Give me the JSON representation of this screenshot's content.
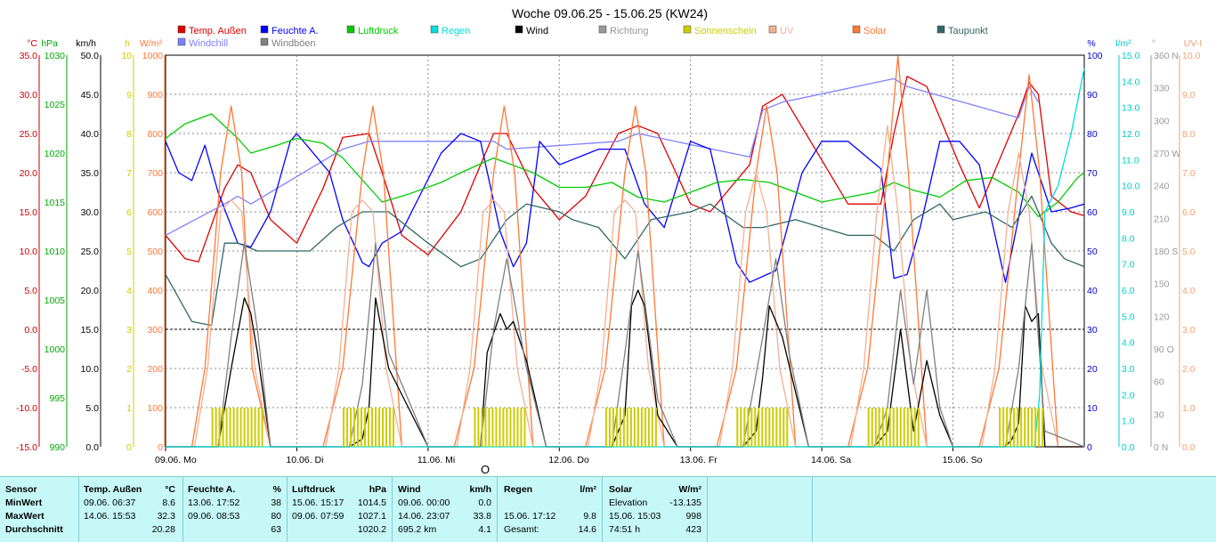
{
  "title": "Woche 09.06.25 - 15.06.25 (KW24)",
  "legend": [
    {
      "label": "Temp. Außen",
      "color": "#dd0000"
    },
    {
      "label": "Feuchte A.",
      "color": "#0000ff"
    },
    {
      "label": "Luftdruck",
      "color": "#00cc00"
    },
    {
      "label": "Regen",
      "color": "#00dddd"
    },
    {
      "label": "Wind",
      "color": "#000000"
    },
    {
      "label": "Richtung",
      "color": "#999999"
    },
    {
      "label": "Sonnenschein",
      "color": "#cccc00"
    },
    {
      "label": "UV",
      "color": "#f4b090"
    },
    {
      "label": "Solar",
      "color": "#ff7733"
    },
    {
      "label": "Taupunkt",
      "color": "#336666"
    },
    {
      "label": "Windchill",
      "color": "#8080ff"
    },
    {
      "label": "Windböen",
      "color": "#808080"
    }
  ],
  "chart_data": {
    "type": "line",
    "title": "Woche 09.06.25 - 15.06.25 (KW24)",
    "x_ticks": [
      "09.06. Mo",
      "10.06. Di",
      "11.06. Mi",
      "12.06. Do",
      "13.06. Fr",
      "14.06. Sa",
      "15.06. So"
    ],
    "axes_left": [
      {
        "unit": "°C",
        "color": "#cc0000",
        "ticks": [
          "35.0",
          "30.0",
          "25.0",
          "20.0",
          "15.0",
          "10.0",
          "5.0",
          "0.0",
          "-5.0",
          "-10.0",
          "-15.0"
        ]
      },
      {
        "unit": "hPa",
        "color": "#00aa00",
        "ticks": [
          "1030",
          "1025",
          "1020",
          "1015",
          "1010",
          "1005",
          "1000",
          "995",
          "990"
        ]
      },
      {
        "unit": "km/h",
        "color": "#000000",
        "ticks": [
          "50.0",
          "45.0",
          "40.0",
          "35.0",
          "30.0",
          "25.0",
          "20.0",
          "15.0",
          "10.0",
          "5.0",
          "0.0"
        ]
      },
      {
        "unit": "h",
        "color": "#cccc00",
        "ticks": [
          "10",
          "9",
          "8",
          "7",
          "6",
          "5",
          "4",
          "3",
          "2",
          "1",
          "0"
        ]
      },
      {
        "unit": "W/m²",
        "color": "#ff7733",
        "ticks": [
          "1000",
          "900",
          "800",
          "700",
          "600",
          "500",
          "400",
          "300",
          "200",
          "100",
          "0"
        ]
      }
    ],
    "axes_right": [
      {
        "unit": "%",
        "color": "#0000cc",
        "ticks": [
          "100",
          "90",
          "80",
          "70",
          "60",
          "50",
          "40",
          "30",
          "20",
          "10",
          "0"
        ]
      },
      {
        "unit": "l/m²",
        "color": "#00cccc",
        "ticks": [
          "15.0",
          "14.0",
          "13.0",
          "12.0",
          "11.0",
          "10.0",
          "9.0",
          "8.0",
          "7.0",
          "6.0",
          "5.0",
          "4.0",
          "3.0",
          "2.0",
          "1.0",
          "0.0"
        ]
      },
      {
        "unit": "°",
        "color": "#999999",
        "ticks": [
          "360 N",
          "330",
          "300",
          "270 W",
          "240",
          "210",
          "180 S",
          "150",
          "120",
          "90 O",
          "60",
          "30",
          "0 N"
        ]
      },
      {
        "unit": "UV-I",
        "color": "#f4a070",
        "ticks": [
          "10.0",
          "9.0",
          "8.0",
          "7.0",
          "6.0",
          "5.0",
          "4.0",
          "3.0",
          "2.0",
          "1.0",
          "0.0"
        ]
      }
    ],
    "series": [
      {
        "name": "Temp. Außen",
        "color": "#dd0000",
        "axis": "°C",
        "x": [
          0,
          0.15,
          0.25,
          0.45,
          0.55,
          0.65,
          0.8,
          1.0,
          1.2,
          1.35,
          1.55,
          1.65,
          1.8,
          2.0,
          2.25,
          2.5,
          2.6,
          2.8,
          3.0,
          3.2,
          3.45,
          3.6,
          3.75,
          4.0,
          4.15,
          4.45,
          4.55,
          4.7,
          4.95,
          5.2,
          5.45,
          5.55,
          5.65,
          5.8,
          5.9,
          6.05,
          6.2,
          6.5,
          6.58,
          6.65,
          6.75,
          6.9,
          7.0
        ],
        "y": [
          12,
          9,
          8.6,
          18,
          21,
          20,
          14,
          11,
          18,
          24.5,
          25,
          20,
          12,
          9.5,
          15,
          25,
          25,
          18,
          14,
          17,
          25,
          26,
          25,
          16,
          15,
          21,
          28.5,
          30,
          23,
          16,
          16,
          25,
          32.3,
          31,
          27,
          21,
          15.5,
          27.5,
          31.5,
          30,
          17,
          15,
          14.5
        ]
      },
      {
        "name": "Windchill",
        "color": "#8080ff",
        "axis": "°C",
        "x": [
          0,
          0.45,
          0.55,
          0.65,
          1.35,
          1.55,
          2.5,
          2.6,
          3.45,
          3.6,
          4.45,
          4.55,
          4.7,
          5.55,
          5.65,
          6.5,
          6.58,
          6.65
        ],
        "y": [
          12,
          16,
          17,
          16,
          23,
          24,
          24,
          23,
          24,
          25,
          22,
          28,
          29,
          32,
          31,
          27,
          31,
          29
        ]
      },
      {
        "name": "Feuchte A.",
        "color": "#0000ff",
        "axis": "%",
        "x": [
          0,
          0.1,
          0.2,
          0.3,
          0.4,
          0.55,
          0.65,
          0.8,
          0.95,
          1.0,
          1.1,
          1.25,
          1.35,
          1.5,
          1.55,
          1.65,
          1.8,
          2.1,
          2.25,
          2.4,
          2.55,
          2.65,
          2.75,
          2.85,
          3.0,
          3.3,
          3.5,
          3.65,
          3.8,
          4.0,
          4.15,
          4.35,
          4.45,
          4.65,
          4.85,
          5.0,
          5.2,
          5.45,
          5.55,
          5.65,
          5.75,
          5.9,
          6.05,
          6.2,
          6.4,
          6.6,
          6.75,
          6.9,
          7.0
        ],
        "y": [
          78,
          70,
          68,
          77,
          65,
          52,
          51,
          60,
          78,
          80,
          76,
          70,
          58,
          47,
          46,
          52,
          55,
          75,
          80,
          78,
          55,
          46,
          52,
          78,
          72,
          76,
          76,
          62,
          56,
          78,
          76,
          47,
          42,
          45,
          70,
          78,
          78,
          71,
          43,
          44,
          56,
          78,
          78,
          72,
          42,
          75,
          60,
          61,
          62
        ]
      },
      {
        "name": "Luftdruck",
        "color": "#00cc00",
        "axis": "hPa",
        "x": [
          0,
          0.15,
          0.35,
          0.55,
          0.65,
          0.85,
          1.0,
          1.2,
          1.35,
          1.55,
          1.65,
          1.85,
          2.1,
          2.25,
          2.5,
          2.6,
          2.8,
          3.0,
          3.2,
          3.4,
          3.6,
          3.8,
          4.0,
          4.2,
          4.4,
          4.6,
          4.8,
          5.0,
          5.2,
          5.4,
          5.55,
          5.7,
          5.9,
          6.1,
          6.3,
          6.5,
          6.65,
          6.8,
          6.95,
          7.0
        ],
        "y": [
          1021.5,
          1023,
          1024,
          1021.5,
          1020,
          1020.8,
          1021.5,
          1021,
          1019.5,
          1016.5,
          1015,
          1015.8,
          1017,
          1018,
          1019.5,
          1019,
          1018,
          1016.5,
          1016.5,
          1017,
          1015.5,
          1015,
          1016,
          1017,
          1017.3,
          1017,
          1016,
          1015,
          1015.5,
          1016,
          1017,
          1016.2,
          1015.5,
          1017.2,
          1017.5,
          1016,
          1013.5,
          1015,
          1017.5,
          1018
        ]
      },
      {
        "name": "Taupunkt",
        "color": "#336666",
        "axis": "°C",
        "x": [
          0,
          0.2,
          0.35,
          0.45,
          0.55,
          0.7,
          0.9,
          1.1,
          1.3,
          1.5,
          1.7,
          2.0,
          2.25,
          2.4,
          2.6,
          2.75,
          3.0,
          3.1,
          3.3,
          3.5,
          3.7,
          4.0,
          4.15,
          4.4,
          4.55,
          4.8,
          5.0,
          5.2,
          5.4,
          5.55,
          5.7,
          5.9,
          6.0,
          6.25,
          6.45,
          6.6,
          6.75,
          6.85,
          7.0
        ],
        "y": [
          7,
          1,
          0.5,
          11,
          11,
          10,
          10,
          10,
          13,
          15,
          15,
          11,
          8,
          9,
          14,
          16,
          15,
          14,
          13,
          9,
          14,
          15,
          16,
          13,
          13,
          14,
          13,
          12,
          12,
          10,
          14,
          16,
          14,
          15,
          13,
          17,
          11,
          9,
          8
        ]
      },
      {
        "name": "Solar",
        "color": "#ff7733",
        "axis": "W/m²",
        "x": [
          0,
          0.2,
          0.3,
          0.42,
          0.5,
          0.58,
          0.66,
          0.8,
          1.2,
          1.35,
          1.5,
          1.58,
          1.66,
          1.8,
          2.2,
          2.35,
          2.5,
          2.58,
          2.66,
          2.8,
          3.2,
          3.35,
          3.5,
          3.58,
          3.66,
          3.8,
          4.2,
          4.35,
          4.5,
          4.58,
          4.66,
          4.8,
          5.2,
          5.35,
          5.5,
          5.58,
          5.66,
          5.8,
          6.2,
          6.35,
          6.5,
          6.58,
          6.66,
          6.8,
          7.0
        ],
        "y": [
          0,
          0,
          200,
          700,
          870,
          700,
          200,
          0,
          0,
          200,
          700,
          870,
          700,
          0,
          0,
          200,
          700,
          870,
          700,
          0,
          0,
          200,
          700,
          870,
          700,
          0,
          0,
          200,
          700,
          870,
          700,
          0,
          0,
          200,
          700,
          998,
          700,
          0,
          0,
          200,
          700,
          950,
          700,
          0,
          0
        ]
      },
      {
        "name": "UV",
        "color": "#f4b090",
        "axis": "UV-I",
        "x": [
          0,
          0.22,
          0.32,
          0.42,
          0.5,
          0.58,
          0.68,
          0.8,
          1.22,
          1.32,
          1.42,
          1.5,
          1.58,
          1.68,
          1.8,
          2.22,
          2.32,
          2.42,
          2.5,
          2.58,
          2.68,
          2.8,
          3.22,
          3.32,
          3.42,
          3.5,
          3.58,
          3.68,
          3.8,
          4.22,
          4.32,
          4.42,
          4.5,
          4.58,
          4.68,
          4.8,
          5.22,
          5.32,
          5.42,
          5.5,
          5.58,
          5.68,
          5.8,
          6.22,
          6.32,
          6.42,
          6.5,
          6.58,
          6.68,
          6.8,
          7.0
        ],
        "y": [
          0,
          0,
          2,
          6,
          6.3,
          6,
          2,
          0,
          0,
          2,
          6,
          6.3,
          6,
          2,
          0,
          0,
          2,
          6,
          6.3,
          6,
          2,
          0,
          0,
          2,
          6,
          6.3,
          6,
          2,
          0,
          0,
          2,
          6,
          7,
          6,
          2,
          0,
          0,
          2,
          6,
          8.2,
          6,
          2,
          0,
          0,
          2,
          6,
          7.5,
          6,
          2,
          0,
          0
        ]
      },
      {
        "name": "Wind",
        "color": "#000000",
        "axis": "km/h",
        "x": [
          0,
          0.4,
          0.5,
          0.6,
          0.65,
          0.7,
          0.8,
          1.0,
          1.4,
          1.5,
          1.55,
          1.6,
          1.7,
          2.0,
          2.4,
          2.45,
          2.55,
          2.6,
          2.65,
          2.75,
          2.9,
          3.0,
          3.4,
          3.5,
          3.55,
          3.6,
          3.65,
          3.75,
          3.9,
          4.0,
          4.4,
          4.5,
          4.55,
          4.6,
          4.7,
          4.9,
          5.0,
          5.4,
          5.5,
          5.6,
          5.7,
          5.8,
          5.9,
          6.0,
          6.4,
          6.45,
          6.5,
          6.55,
          6.6,
          6.65,
          6.7,
          7.0
        ],
        "y": [
          0,
          0,
          10,
          19,
          17,
          12,
          0,
          0,
          0,
          1,
          5,
          19,
          10,
          0,
          0,
          12,
          17,
          15,
          16,
          11,
          0,
          0,
          0,
          4,
          18,
          20,
          18,
          4,
          0,
          0,
          0,
          2,
          9,
          18,
          14,
          0,
          0,
          0,
          2,
          15,
          2,
          11,
          4,
          0,
          0,
          1,
          3,
          18,
          16,
          17,
          0,
          0
        ]
      },
      {
        "name": "Windböen",
        "color": "#808080",
        "axis": "km/h",
        "x": [
          0,
          0.4,
          0.5,
          0.6,
          0.7,
          0.8,
          1.0,
          1.4,
          1.5,
          1.6,
          1.7,
          2.0,
          2.4,
          2.5,
          2.6,
          2.75,
          2.9,
          3.0,
          3.4,
          3.5,
          3.6,
          3.75,
          3.9,
          4.0,
          4.4,
          4.55,
          4.65,
          4.75,
          4.9,
          5.0,
          5.4,
          5.5,
          5.6,
          5.7,
          5.8,
          5.9,
          6.0,
          6.4,
          6.5,
          6.6,
          6.7,
          7.0
        ],
        "y": [
          0,
          0,
          14,
          26,
          15,
          0,
          0,
          0,
          8,
          26,
          12,
          0,
          0,
          15,
          24,
          10,
          0,
          0,
          0,
          12,
          25,
          6,
          0,
          0,
          0,
          14,
          24,
          12,
          0,
          0,
          0,
          5,
          20,
          8,
          20,
          5,
          0,
          0,
          10,
          26,
          2,
          0
        ]
      },
      {
        "name": "Regen",
        "color": "#00dddd",
        "axis": "l/m²",
        "x": [
          0,
          6.62,
          6.66,
          6.7,
          6.8,
          6.9,
          7.0
        ],
        "y": [
          0,
          0,
          2,
          9,
          10,
          12,
          14.5
        ]
      },
      {
        "name": "Sonnenschein",
        "color": "#cccc00",
        "axis": "h",
        "x": [
          0.35,
          0.75,
          1.35,
          1.75,
          2.35,
          2.75,
          3.35,
          3.75,
          4.35,
          4.75,
          5.35,
          5.75,
          6.35,
          6.7
        ],
        "y": [
          1,
          1,
          1,
          1,
          1,
          1,
          1,
          1,
          1,
          1,
          1,
          1,
          1,
          1
        ]
      }
    ]
  },
  "stats": {
    "sensor": {
      "title": "Sensor",
      "rows": [
        "MinWert",
        "MaxWert",
        "Durchschnitt"
      ]
    },
    "temp": {
      "title": "Temp. Außen",
      "unit": "°C",
      "min": {
        "time": "09.06.  06:37",
        "value": "8.6"
      },
      "max": {
        "time": "14.06.  15:53",
        "value": "32.3"
      },
      "avg": "20.28"
    },
    "feuchte": {
      "title": "Feuchte A.",
      "unit": "%",
      "min": {
        "time": "13.06.  17:52",
        "value": "38"
      },
      "max": {
        "time": "09.06.  08:53",
        "value": "80"
      },
      "avg": "63"
    },
    "luftdruck": {
      "title": "Luftdruck",
      "unit": "hPa",
      "min": {
        "time": "15.06.  15:17",
        "value": "1014.5"
      },
      "max": {
        "time": "09.06.  07:59",
        "value": "1027.1"
      },
      "avg": "1020.2"
    },
    "wind": {
      "title": "Wind",
      "unit": "km/h",
      "min": {
        "time": "09.06.  00:00",
        "value": "0.0"
      },
      "max": {
        "time": "14.06.  23:07",
        "value": "33.8"
      },
      "avg_label": "695.2 km",
      "avg": "4.1"
    },
    "regen": {
      "title": "Regen",
      "unit": "l/m²",
      "max": {
        "time": "15.06.  17:12",
        "value": "9.8"
      },
      "total_label": "Gesamt:",
      "total": "14.6"
    },
    "solar": {
      "title": "Solar",
      "unit": "W/m²",
      "min": {
        "label": "Elevation",
        "value": "-13.135"
      },
      "max": {
        "time": "15.06.  15:03",
        "value": "998"
      },
      "avg": {
        "label": "74:51 h",
        "value": "423"
      }
    }
  }
}
